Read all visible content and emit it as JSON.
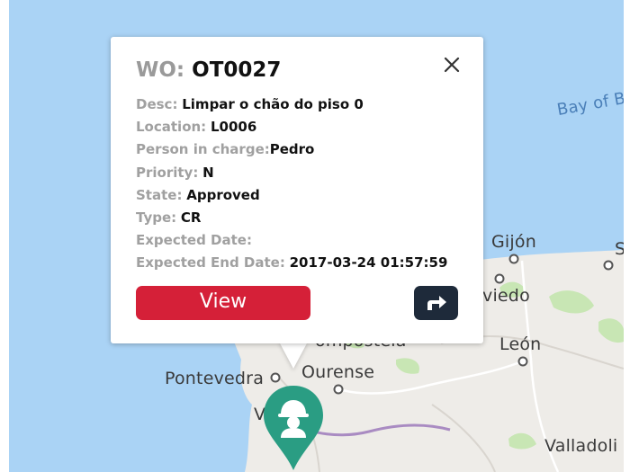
{
  "map": {
    "labels": {
      "bay": "Bay of B",
      "gijon": "Gijón",
      "oviedo": "viedo",
      "leon": "León",
      "pontevedra": "Pontevedra",
      "ourense": "Ourense",
      "compostela": "ompostela",
      "valladolid": "Valladoli",
      "edge_s": "S",
      "edge_v": "V"
    },
    "colors": {
      "water": "#aad3f5",
      "land": "#eeece8",
      "park": "#c8e6b4",
      "marker": "#2a9d83"
    }
  },
  "popup": {
    "title_key": "WO:",
    "title_value": "OT0027",
    "close_icon": "close-icon",
    "rows": [
      {
        "key": "Desc:",
        "value": "Limpar o chão do piso 0"
      },
      {
        "key": "Location:",
        "value": "L0006"
      },
      {
        "key": "Person in charge:",
        "value": "Pedro"
      },
      {
        "key": "Priority:",
        "value": "N"
      },
      {
        "key": "State:",
        "value": "Approved"
      },
      {
        "key": "Type:",
        "value": "CR"
      },
      {
        "key": "Expected Date:",
        "value": ""
      },
      {
        "key": "Expected End Date:",
        "value": "2017-03-24 01:57:59"
      }
    ],
    "view_label": "View",
    "route_icon": "route-arrow-icon",
    "colors": {
      "view": "#d52038",
      "route": "#1e2a3a"
    }
  },
  "marker": {
    "icon": "worker-helmet-icon"
  }
}
